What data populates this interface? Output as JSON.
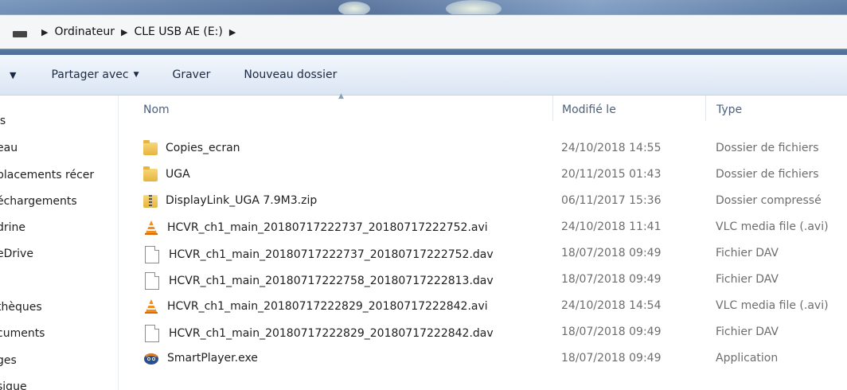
{
  "breadcrumb": {
    "items": [
      "Ordinateur",
      "CLE USB AE (E:)"
    ]
  },
  "toolbar": {
    "share_label": "Partager avec",
    "burn_label": "Graver",
    "new_folder_label": "Nouveau dossier"
  },
  "nav": {
    "items": [
      "is",
      "eau",
      "placements récer",
      "échargements",
      "drine",
      "eDrive",
      "thèques",
      "cuments",
      "ges",
      "sique"
    ]
  },
  "columns": {
    "name": "Nom",
    "modified": "Modifié le",
    "type": "Type"
  },
  "files": [
    {
      "name": "Copies_ecran",
      "date": "24/10/2018 14:55",
      "type": "Dossier de fichiers",
      "icon": "folder-icon"
    },
    {
      "name": "UGA",
      "date": "20/11/2015 01:43",
      "type": "Dossier de fichiers",
      "icon": "folder-icon"
    },
    {
      "name": "DisplayLink_UGA 7.9M3.zip",
      "date": "06/11/2017 15:36",
      "type": "Dossier compressé",
      "icon": "zip-icon"
    },
    {
      "name": "HCVR_ch1_main_20180717222737_20180717222752.avi",
      "date": "24/10/2018 11:41",
      "type": "VLC media file (.avi)",
      "icon": "vlc-icon"
    },
    {
      "name": "HCVR_ch1_main_20180717222737_20180717222752.dav",
      "date": "18/07/2018 09:49",
      "type": "Fichier DAV",
      "icon": "file-icon"
    },
    {
      "name": "HCVR_ch1_main_20180717222758_20180717222813.dav",
      "date": "18/07/2018 09:49",
      "type": "Fichier DAV",
      "icon": "file-icon"
    },
    {
      "name": "HCVR_ch1_main_20180717222829_20180717222842.avi",
      "date": "24/10/2018 14:54",
      "type": "VLC media file (.avi)",
      "icon": "vlc-icon"
    },
    {
      "name": "HCVR_ch1_main_20180717222829_20180717222842.dav",
      "date": "18/07/2018 09:49",
      "type": "Fichier DAV",
      "icon": "file-icon"
    },
    {
      "name": "SmartPlayer.exe",
      "date": "18/07/2018 09:49",
      "type": "Application",
      "icon": "app-icon"
    }
  ],
  "colors": {
    "toolbar_text": "#1b2a44",
    "header_text": "#4c607a",
    "meta_text": "#6d6d6d"
  }
}
